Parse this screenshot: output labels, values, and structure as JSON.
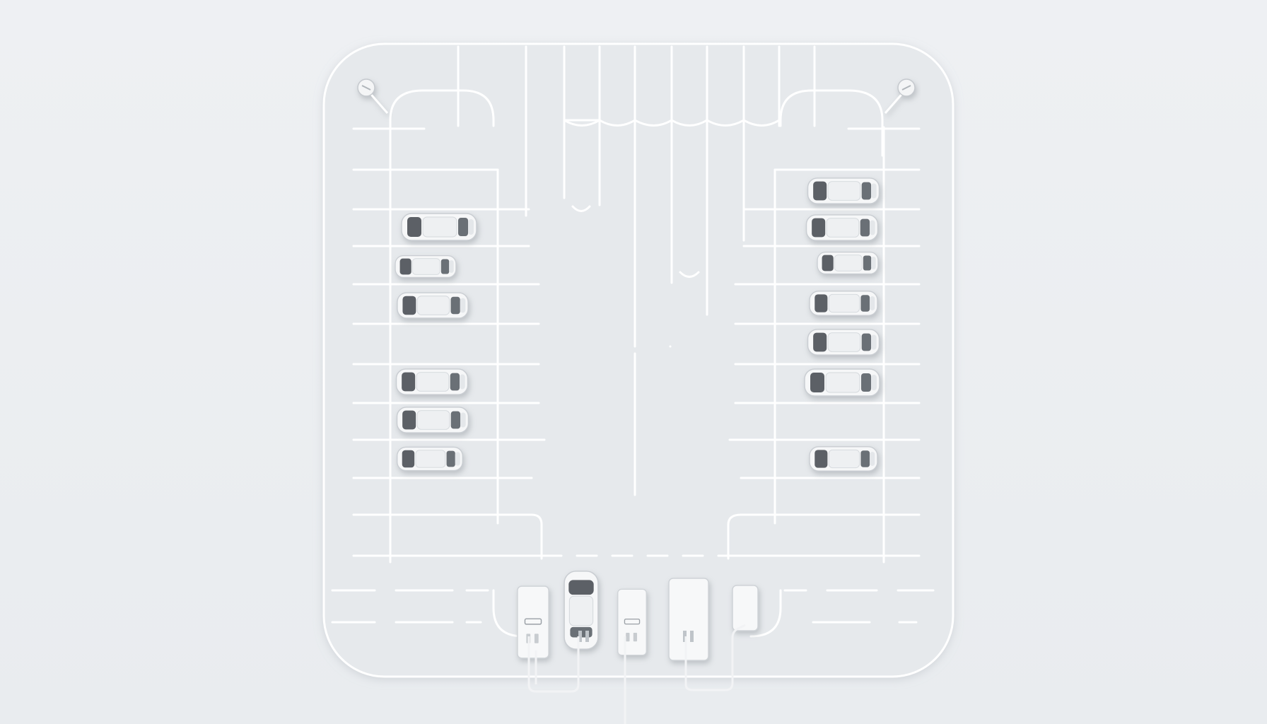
{
  "scene": {
    "subject": "parking-lot-top-view",
    "colors": {
      "background": "#ebeef1",
      "lot_surface": "#e6e9ec",
      "markings": "#ffffff",
      "car_body": "#f6f7f8",
      "car_glass": "#55595e",
      "charger_body": "#f7f8f9"
    },
    "left_row_cars": 6,
    "right_row_cars": 7,
    "charging_stations": 4,
    "charging_car": 1
  }
}
